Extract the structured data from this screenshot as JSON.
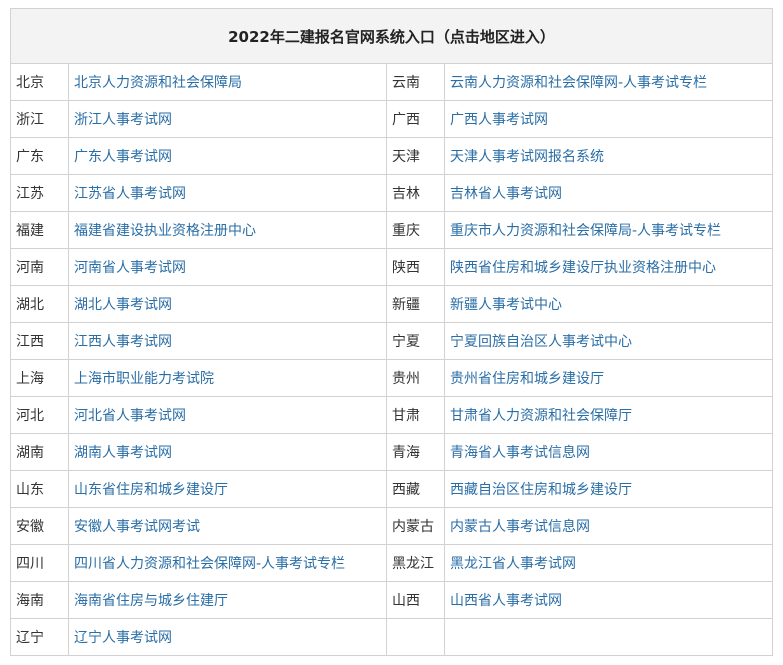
{
  "table": {
    "title": "2022年二建报名官网系统入口（点击地区进入）",
    "link_color": "#2a6ea6",
    "rows": [
      {
        "left_region": "北京",
        "left_link": "北京人力资源和社会保障局",
        "right_region": "云南",
        "right_link": "云南人力资源和社会保障网-人事考试专栏"
      },
      {
        "left_region": "浙江",
        "left_link": "浙江人事考试网",
        "right_region": "广西",
        "right_link": "广西人事考试网"
      },
      {
        "left_region": "广东",
        "left_link": "广东人事考试网",
        "right_region": "天津",
        "right_link": "天津人事考试网报名系统"
      },
      {
        "left_region": "江苏",
        "left_link": "江苏省人事考试网",
        "right_region": "吉林",
        "right_link": "吉林省人事考试网"
      },
      {
        "left_region": "福建",
        "left_link": "福建省建设执业资格注册中心",
        "right_region": "重庆",
        "right_link": "重庆市人力资源和社会保障局-人事考试专栏"
      },
      {
        "left_region": "河南",
        "left_link": "河南省人事考试网",
        "right_region": "陕西",
        "right_link": "陕西省住房和城乡建设厅执业资格注册中心"
      },
      {
        "left_region": "湖北",
        "left_link": "湖北人事考试网",
        "right_region": "新疆",
        "right_link": "新疆人事考试中心"
      },
      {
        "left_region": "江西",
        "left_link": "江西人事考试网",
        "right_region": "宁夏",
        "right_link": "宁夏回族自治区人事考试中心"
      },
      {
        "left_region": "上海",
        "left_link": "上海市职业能力考试院",
        "right_region": "贵州",
        "right_link": "贵州省住房和城乡建设厅"
      },
      {
        "left_region": "河北",
        "left_link": "河北省人事考试网",
        "right_region": "甘肃",
        "right_link": "甘肃省人力资源和社会保障厅"
      },
      {
        "left_region": "湖南",
        "left_link": "湖南人事考试网",
        "right_region": "青海",
        "right_link": "青海省人事考试信息网"
      },
      {
        "left_region": "山东",
        "left_link": "山东省住房和城乡建设厅",
        "right_region": "西藏",
        "right_link": "西藏自治区住房和城乡建设厅"
      },
      {
        "left_region": "安徽",
        "left_link": "安徽人事考试网考试",
        "right_region": "内蒙古",
        "right_link": "内蒙古人事考试信息网"
      },
      {
        "left_region": "四川",
        "left_link": "四川省人力资源和社会保障网-人事考试专栏",
        "right_region": "黑龙江",
        "right_link": "黑龙江省人事考试网"
      },
      {
        "left_region": "海南",
        "left_link": "海南省住房与城乡住建厅",
        "right_region": "山西",
        "right_link": "山西省人事考试网"
      },
      {
        "left_region": "辽宁",
        "left_link": "辽宁人事考试网",
        "right_region": "",
        "right_link": ""
      }
    ]
  }
}
